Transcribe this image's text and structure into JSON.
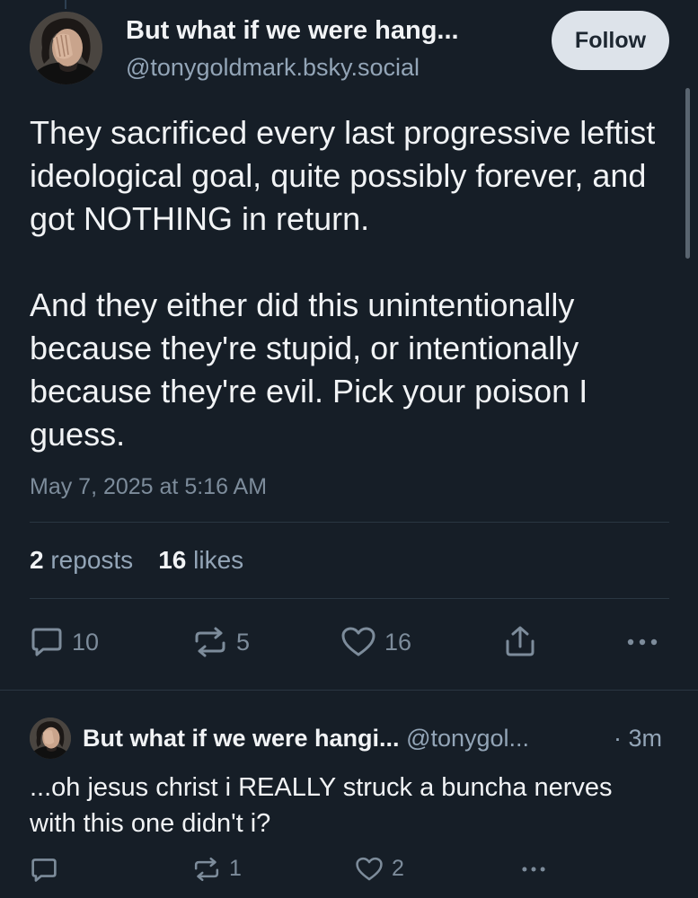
{
  "post": {
    "author_name": "But what if we were hang...",
    "author_handle": "@tonygoldmark.bsky.social",
    "follow_label": "Follow",
    "text_paragraphs": [
      "They sacrificed every last progressive leftist ideological goal, quite possibly forever, and got NOTHING in return.",
      "And they either did this unintentionally because they're stupid, or intentionally because they're evil. Pick your poison I guess."
    ],
    "timestamp": "May 7, 2025 at 5:16 AM",
    "stats": {
      "reposts_count": "2",
      "reposts_label": "reposts",
      "likes_count": "16",
      "likes_label": "likes"
    },
    "actions": {
      "reply_count": "10",
      "repost_count": "5",
      "like_count": "16"
    },
    "icons": [
      "reply-icon",
      "repost-icon",
      "like-icon",
      "share-icon",
      "more-icon"
    ]
  },
  "reply": {
    "author_name": "But what if we were hangi...",
    "author_handle": "@tonygol...",
    "time": "· 3m",
    "text": "...oh jesus christ i REALLY struck a buncha nerves with this one didn't i?",
    "actions": {
      "reply_count": "",
      "repost_count": "1",
      "like_count": "2"
    }
  },
  "colors": {
    "background": "#161e27",
    "text_primary": "#f1f3f5",
    "text_secondary": "#93a5b7",
    "icon_muted": "#7d8c9b",
    "follow_button_bg": "#dde3ea"
  }
}
